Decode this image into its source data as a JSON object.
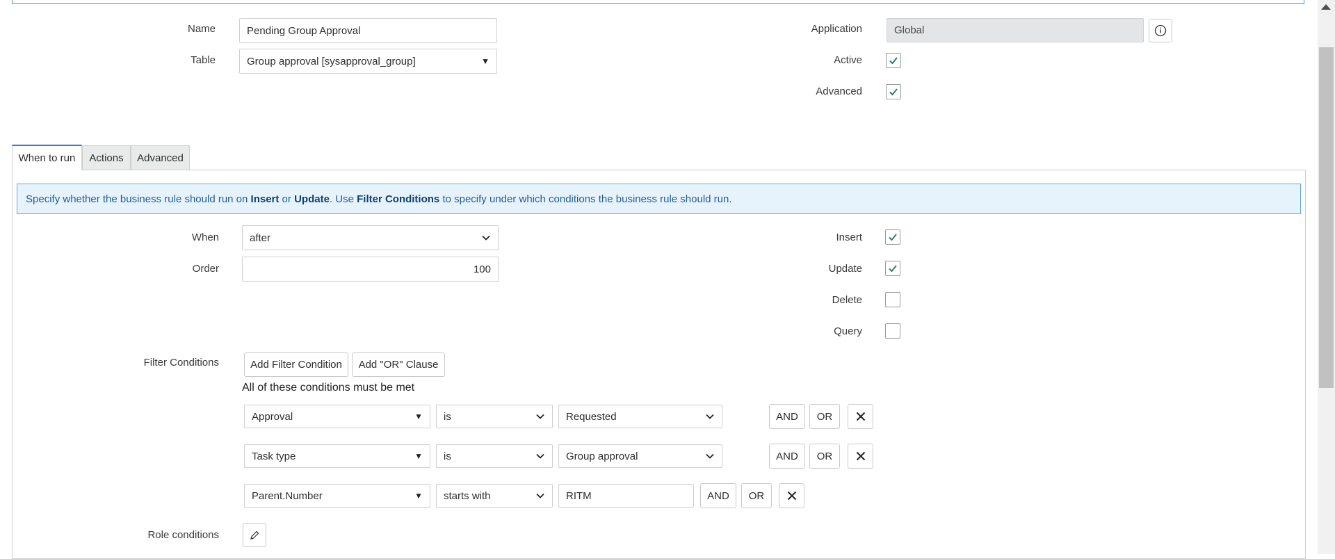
{
  "form": {
    "name_label": "Name",
    "name_value": "Pending Group Approval",
    "table_label": "Table",
    "table_value": "Group approval [sysapproval_group]",
    "application_label": "Application",
    "application_value": "Global",
    "active_label": "Active",
    "active_checked": true,
    "advanced_label": "Advanced",
    "advanced_checked": true
  },
  "tabs": [
    {
      "label": "When to run",
      "active": true
    },
    {
      "label": "Actions",
      "active": false
    },
    {
      "label": "Advanced",
      "active": false
    }
  ],
  "info": {
    "t1": "Specify whether the business rule should run on ",
    "b1": "Insert",
    "t2": " or ",
    "b2": "Update",
    "t3": ". Use ",
    "b3": "Filter Conditions",
    "t4": " to specify under which conditions the business rule should run."
  },
  "when_to_run": {
    "when_label": "When",
    "when_value": "after",
    "order_label": "Order",
    "order_value": "100",
    "insert_label": "Insert",
    "insert_checked": true,
    "update_label": "Update",
    "update_checked": true,
    "delete_label": "Delete",
    "delete_checked": false,
    "query_label": "Query",
    "query_checked": false
  },
  "filter": {
    "label": "Filter Conditions",
    "add_condition": "Add Filter Condition",
    "add_or": "Add \"OR\" Clause",
    "caption": "All of these conditions must be met",
    "and_label": "AND",
    "or_label": "OR",
    "rows": [
      {
        "field": "Approval",
        "operator": "is",
        "value": "Requested"
      },
      {
        "field": "Task type",
        "operator": "is",
        "value": "Group approval"
      },
      {
        "field": "Parent.Number",
        "operator": "starts with",
        "value": "RITM"
      }
    ]
  },
  "role_conditions_label": "Role conditions",
  "icons": {
    "info": "info-icon",
    "check": "check-icon",
    "dropdown_triangle": "triangle-down-icon",
    "chevron": "chevron-down-icon",
    "remove": "close-icon",
    "edit": "pencil-icon"
  },
  "colors": {
    "accent": "#2f7fd1",
    "check": "#2e7d6f",
    "info_bg": "#e7f3fc",
    "info_border": "#5aa7e0"
  }
}
